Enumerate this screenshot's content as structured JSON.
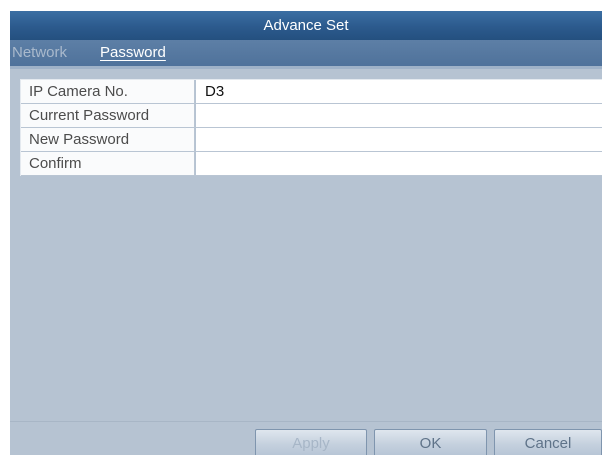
{
  "window": {
    "title": "Advance Set"
  },
  "tabs": [
    {
      "label": "Network",
      "active": false
    },
    {
      "label": "Password",
      "active": true
    }
  ],
  "form": {
    "rows": [
      {
        "label": "IP Camera No.",
        "value": "D3"
      },
      {
        "label": "Current Password",
        "value": ""
      },
      {
        "label": "New Password",
        "value": ""
      },
      {
        "label": "Confirm",
        "value": ""
      }
    ]
  },
  "buttons": {
    "apply": "Apply",
    "ok": "OK",
    "cancel": "Cancel"
  },
  "colors": {
    "title_bar": "#2c5a8d",
    "tab_bar": "#4f729b",
    "panel_background": "#b6c3d2",
    "active_tab_text": "#ffffff",
    "disabled_text": "#a7b6c7"
  }
}
